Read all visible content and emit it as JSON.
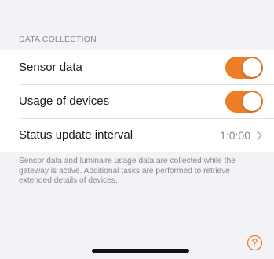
{
  "section": {
    "header": "DATA COLLECTION"
  },
  "rows": [
    {
      "label": "Sensor data",
      "toggle": true
    },
    {
      "label": "Usage of devices",
      "toggle": true
    },
    {
      "label": "Status update interval",
      "value": "1:0:00"
    }
  ],
  "footer_note": "Sensor data and luminaire usage data are collected while the gateway is active. Additional tasks are performed to retrieve extended details of devices.",
  "icons": {
    "chevron": "chevron-right-icon",
    "help": "help-icon"
  },
  "colors": {
    "accent": "#ee7d28",
    "background": "#f2f2f7",
    "secondary_text": "#8a8a8e"
  }
}
